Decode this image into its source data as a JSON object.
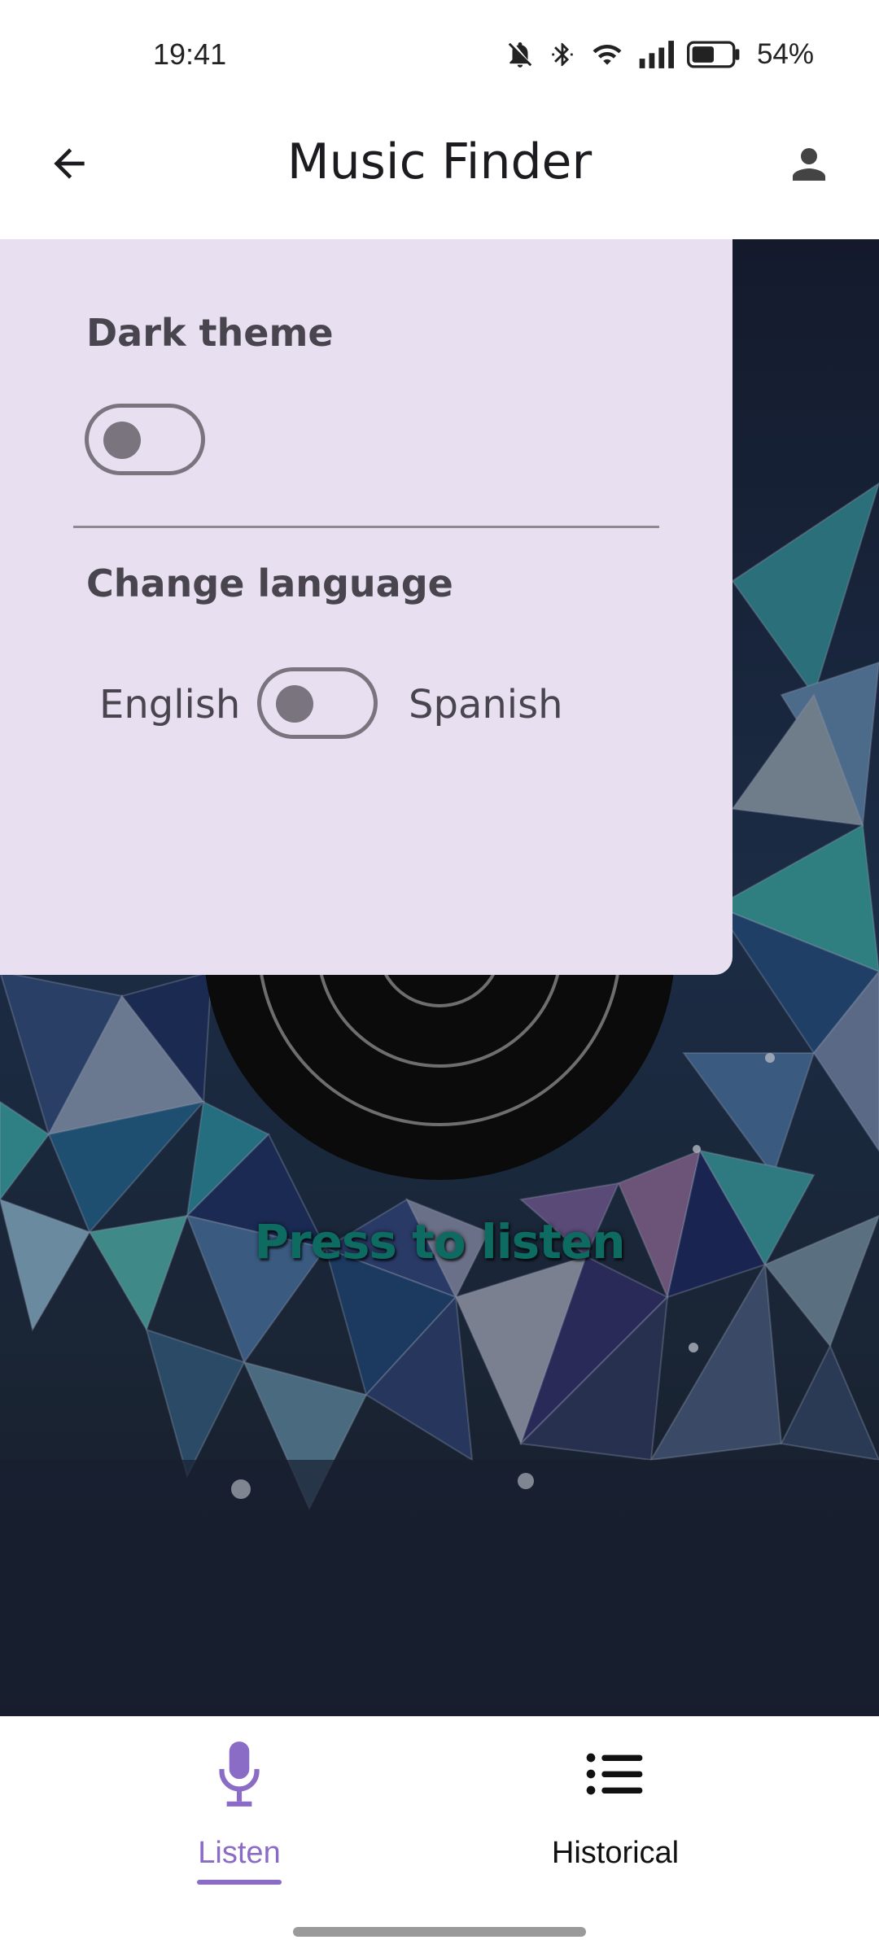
{
  "status_bar": {
    "time": "19:41",
    "battery_percent": "54%",
    "icons": [
      "bell-muted-icon",
      "bluetooth-icon",
      "wifi-icon",
      "signal-icon",
      "battery-icon"
    ]
  },
  "app_bar": {
    "title": "Music Finder",
    "back_icon": "arrow-back-icon",
    "account_icon": "account-icon"
  },
  "settings": {
    "dark_theme_label": "Dark theme",
    "dark_theme_enabled": false,
    "change_language_label": "Change language",
    "language_left": "English",
    "language_right": "Spanish",
    "spanish_selected": false
  },
  "main": {
    "press_to_listen": "Press to listen"
  },
  "bottom_nav": {
    "items": [
      {
        "label": "Listen",
        "icon": "microphone-icon",
        "active": true
      },
      {
        "label": "Historical",
        "icon": "list-icon",
        "active": false
      }
    ]
  },
  "colors": {
    "panel_bg": "#e8dff0",
    "accent": "#8a6bc6",
    "listen_text": "#0e6b62"
  }
}
